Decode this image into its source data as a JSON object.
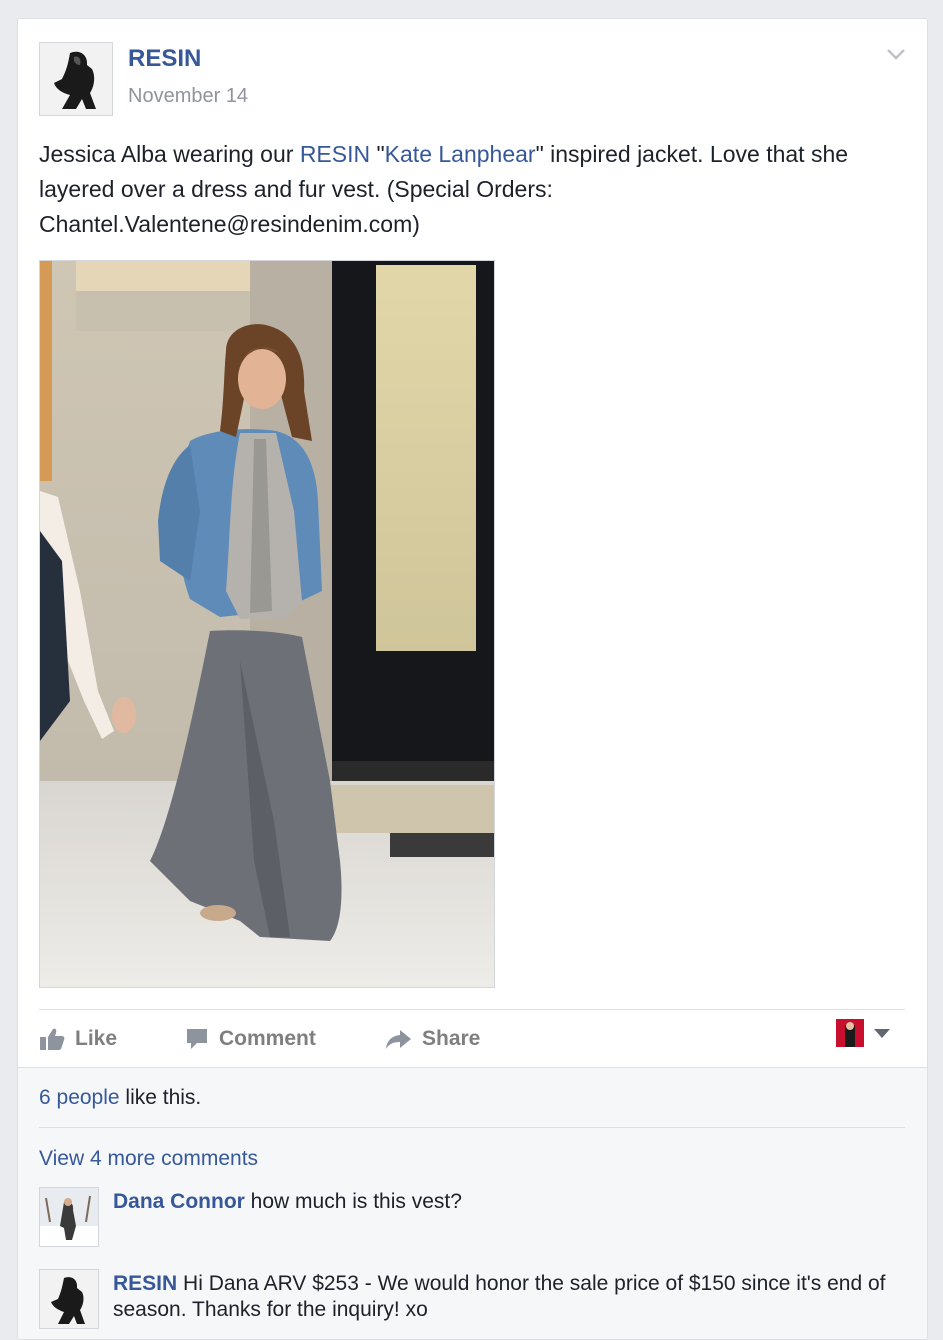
{
  "post": {
    "page_name": "RESIN",
    "date": "November 14",
    "text_before": "Jessica Alba wearing our ",
    "link_brand": "RESIN",
    "text_quote_open": " \"",
    "link_person": "Kate Lanphear",
    "text_after": "\" inspired jacket. Love that she layered over a dress and fur vest. (Special Orders: Chantel.Valentene@resindenim.com)"
  },
  "actions": {
    "like": "Like",
    "comment": "Comment",
    "share": "Share"
  },
  "likes": {
    "count_link": "6 people",
    "suffix": " like this."
  },
  "comments": {
    "view_more": "View 4 more comments",
    "items": [
      {
        "author": "Dana Connor",
        "text": " how much is this vest?"
      },
      {
        "author": "RESIN",
        "text": " Hi Dana ARV $253 - We would honor the sale price of $150 since it's end of season. Thanks for the inquiry! xo"
      }
    ]
  },
  "colors": {
    "link": "#365899",
    "meta": "#90949c",
    "action": "#7f7f7f",
    "background": "#e9ebee"
  },
  "icons": [
    "chevron-down-icon",
    "thumbs-up-icon",
    "comment-bubble-icon",
    "share-arrow-icon",
    "caret-down-icon"
  ]
}
